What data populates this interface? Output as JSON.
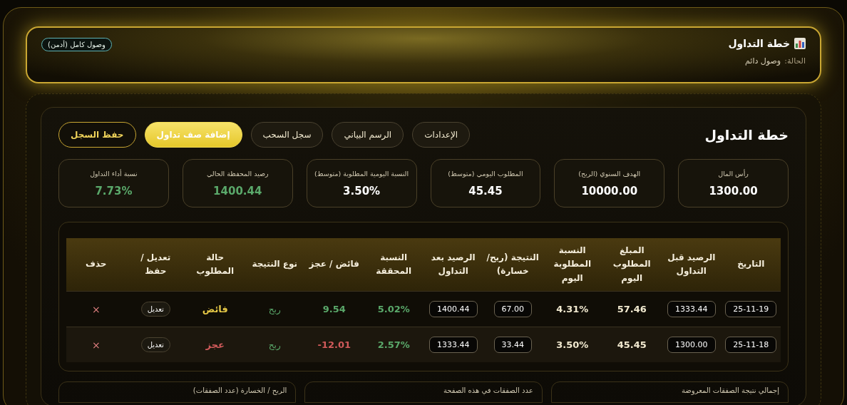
{
  "header": {
    "title": "خطة التداول",
    "status_label": "الحالة:",
    "status_value": "وصول دائم",
    "access_badge": "وصول كامل (أدمن)"
  },
  "panel": {
    "title": "خطة التداول",
    "actions": [
      {
        "label": "الإعدادات",
        "kind": "plain"
      },
      {
        "label": "الرسم البياني",
        "kind": "plain"
      },
      {
        "label": "سجل السحب",
        "kind": "plain"
      },
      {
        "label": "إضافة صف تداول",
        "kind": "primary"
      },
      {
        "label": "حفظ السجل",
        "kind": "outline"
      }
    ]
  },
  "stats": [
    {
      "label": "رأس المال",
      "value": "1300.00",
      "kind": "plain"
    },
    {
      "label": "الهدف السنوي (الربح)",
      "value": "10000.00",
      "kind": "plain"
    },
    {
      "label": "المطلوب اليومي (متوسط)",
      "value": "45.45",
      "kind": "plain"
    },
    {
      "label": "النسبة اليومية المطلوبة (متوسط)",
      "value": "3.50%",
      "kind": "plain"
    },
    {
      "label": "رصيد المحفظة الحالي",
      "value": "1400.44",
      "kind": "positive"
    },
    {
      "label": "نسبة أداء التداول",
      "value": "7.73%",
      "kind": "positive"
    }
  ],
  "table": {
    "columns": [
      "التاريخ",
      "الرصيد قبل التداول",
      "المبلغ المطلوب اليوم",
      "النسبة المطلوبة اليوم",
      "النتيجة (ربح/ خسارة)",
      "الرصيد بعد التداول",
      "النسبة المحققة",
      "فائض / عجز",
      "نوع النتيجة",
      "حالة المطلوب",
      "تعديل / حفظ",
      "حذف"
    ],
    "rows": [
      {
        "date": "25-11-19",
        "before": "1333.44",
        "required_amount": "57.46",
        "required_pct": "4.31%",
        "result": "67.00",
        "after": "1400.44",
        "achieved_pct": "5.02%",
        "surplus": "9.54",
        "result_type": "ربح",
        "status": "فائض",
        "kind": "surplus",
        "edit": "تعديل",
        "delete": "×"
      },
      {
        "date": "25-11-18",
        "before": "1300.00",
        "required_amount": "45.45",
        "required_pct": "3.50%",
        "result": "33.44",
        "after": "1333.44",
        "achieved_pct": "2.57%",
        "surplus": "12.01-",
        "result_type": "ربح",
        "status": "عجز",
        "kind": "deficit",
        "edit": "تعديل",
        "delete": "×"
      }
    ]
  },
  "summary_cards": [
    {
      "label": "إجمالي نتيجة الصفقات المعروضة"
    },
    {
      "label": "عدد الصفقات في هذه الصفحة"
    },
    {
      "label": "الربح / الخسارة (عدد الصفقات)"
    }
  ]
}
